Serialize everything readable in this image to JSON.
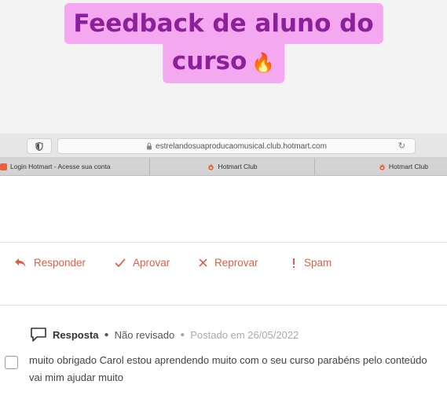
{
  "headline": {
    "line1": "Feedback de aluno do",
    "line2": "curso",
    "emoji": "🔥"
  },
  "browser": {
    "url": "estrelandosuaproducaomusical.club.hotmart.com",
    "tabs": [
      {
        "label": "Login Hotmart - Acesse sua conta"
      },
      {
        "label": "Hotmart Club"
      },
      {
        "label": "Hotmart Club"
      }
    ]
  },
  "actions": {
    "reply": "Responder",
    "approve": "Aprovar",
    "reject": "Reprovar",
    "spam": "Spam"
  },
  "comment": {
    "type": "Resposta",
    "status": "Não revisado",
    "posted": "Postado em 26/05/2022",
    "text": "muito obrigado Carol estou aprendendo muito com o seu curso parabéns pelo conteúdo vai mim ajudar muito"
  },
  "colors": {
    "accent": "#d9624a",
    "headline_bg": "#f4a8f0",
    "headline_text": "#8c1f9a",
    "hotmart": "#e8613a"
  }
}
